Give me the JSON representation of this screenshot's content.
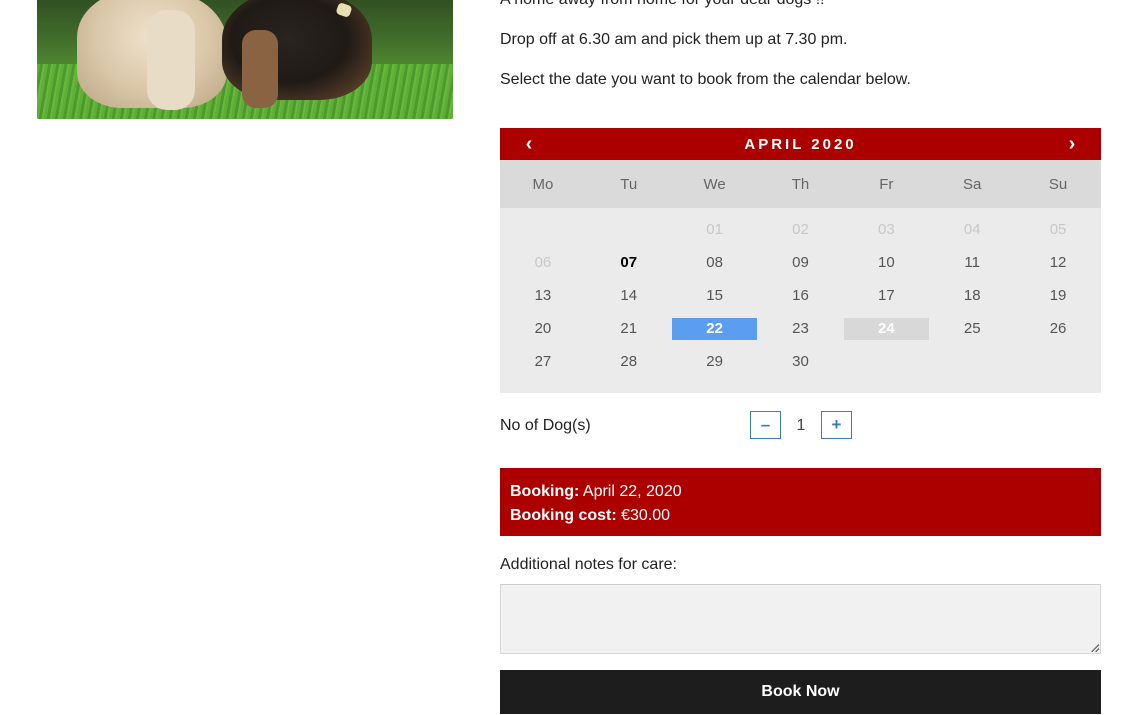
{
  "intro": {
    "line1": "A home away from home for your dear dogs !!",
    "line2": "Drop off at 6.30 am and pick them up at 7.30 pm.",
    "line3": "Select the date you want to book from the calendar below."
  },
  "calendar": {
    "title": "APRIL 2020",
    "prev_icon": "‹",
    "next_icon": "›",
    "weekdays": [
      "Mo",
      "Tu",
      "We",
      "Th",
      "Fr",
      "Sa",
      "Su"
    ],
    "leading_blanks": 2,
    "days": [
      {
        "label": "01",
        "state": "disabled"
      },
      {
        "label": "02",
        "state": "disabled"
      },
      {
        "label": "03",
        "state": "disabled"
      },
      {
        "label": "04",
        "state": "disabled"
      },
      {
        "label": "05",
        "state": "disabled"
      },
      {
        "label": "06",
        "state": "disabled"
      },
      {
        "label": "07",
        "state": "today"
      },
      {
        "label": "08",
        "state": "available"
      },
      {
        "label": "09",
        "state": "available"
      },
      {
        "label": "10",
        "state": "available"
      },
      {
        "label": "11",
        "state": "available"
      },
      {
        "label": "12",
        "state": "available"
      },
      {
        "label": "13",
        "state": "available"
      },
      {
        "label": "14",
        "state": "available"
      },
      {
        "label": "15",
        "state": "available"
      },
      {
        "label": "16",
        "state": "available"
      },
      {
        "label": "17",
        "state": "available"
      },
      {
        "label": "18",
        "state": "available"
      },
      {
        "label": "19",
        "state": "available"
      },
      {
        "label": "20",
        "state": "available"
      },
      {
        "label": "21",
        "state": "available"
      },
      {
        "label": "22",
        "state": "selected"
      },
      {
        "label": "23",
        "state": "available"
      },
      {
        "label": "24",
        "state": "booked"
      },
      {
        "label": "25",
        "state": "available"
      },
      {
        "label": "26",
        "state": "available"
      },
      {
        "label": "27",
        "state": "available"
      },
      {
        "label": "28",
        "state": "available"
      },
      {
        "label": "29",
        "state": "available"
      },
      {
        "label": "30",
        "state": "available"
      }
    ]
  },
  "quantity": {
    "label": "No of Dog(s)",
    "value": "1",
    "minus_label": "–",
    "plus_label": "+"
  },
  "summary": {
    "booking_label": "Booking:",
    "booking_value": "April 22, 2020",
    "cost_label": "Booking cost:",
    "cost_value": "€30.00"
  },
  "notes": {
    "label": "Additional notes for care:",
    "value": ""
  },
  "book_button": {
    "label": "Book Now"
  },
  "colors": {
    "accent_red": "#ac0000",
    "selected_blue": "#5b9ef0",
    "button_dark": "#1d1d1d",
    "qty_blue": "#3a7fb0"
  }
}
